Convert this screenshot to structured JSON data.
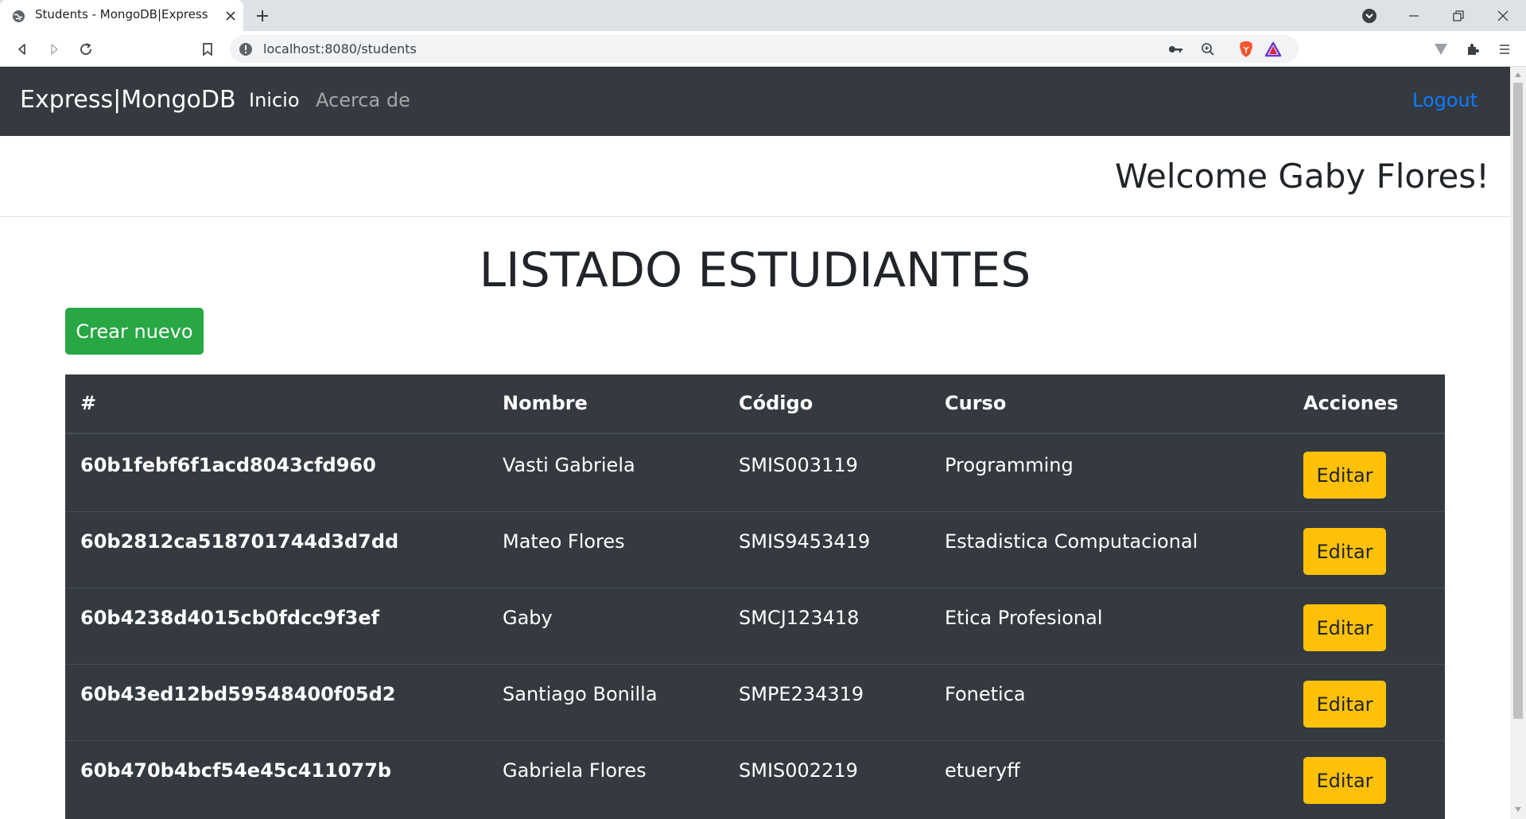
{
  "browser": {
    "tab_title": "Students - MongoDB|Express",
    "url": "localhost:8080/students"
  },
  "navbar": {
    "brand": "Express|MongoDB",
    "links": [
      {
        "label": "Inicio"
      },
      {
        "label": "Acerca de"
      }
    ],
    "logout": "Logout"
  },
  "welcome": "Welcome Gaby Flores!",
  "page_title": "LISTADO ESTUDIANTES",
  "create_button": "Crear nuevo",
  "table": {
    "headers": [
      "#",
      "Nombre",
      "Código",
      "Curso",
      "Acciones"
    ],
    "rows": [
      {
        "id": "60b1febf6f1acd8043cfd960",
        "nombre": "Vasti Gabriela",
        "codigo": "SMIS003119",
        "curso": "Programming",
        "accion": "Editar"
      },
      {
        "id": "60b2812ca518701744d3d7dd",
        "nombre": "Mateo Flores",
        "codigo": "SMIS9453419",
        "curso": "Estadistica Computacional",
        "accion": "Editar"
      },
      {
        "id": "60b4238d4015cb0fdcc9f3ef",
        "nombre": "Gaby",
        "codigo": "SMCJ123418",
        "curso": "Etica Profesional",
        "accion": "Editar"
      },
      {
        "id": "60b43ed12bd59548400f05d2",
        "nombre": "Santiago Bonilla",
        "codigo": "SMPE234319",
        "curso": "Fonetica",
        "accion": "Editar"
      },
      {
        "id": "60b470b4bcf54e45c411077b",
        "nombre": "Gabriela Flores",
        "codigo": "SMIS002219",
        "curso": "etueryff",
        "accion": "Editar"
      }
    ]
  },
  "colors": {
    "navbar_bg": "#343a40",
    "success": "#28a745",
    "warning": "#ffc107",
    "link_blue": "#0d7bff"
  }
}
